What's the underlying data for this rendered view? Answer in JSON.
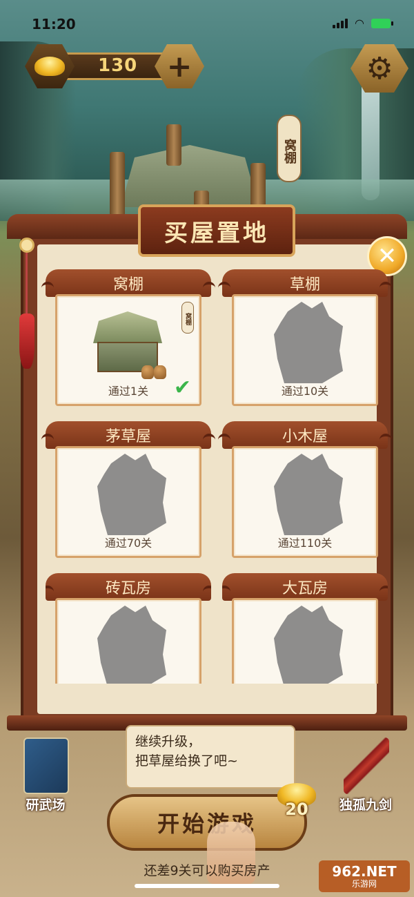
{
  "status_bar": {
    "time": "11:20"
  },
  "hud": {
    "coins": "130",
    "add_label": "+",
    "settings_icon": "gear-icon"
  },
  "scene": {
    "sign": "窝棚"
  },
  "modal": {
    "title": "买屋置地",
    "close_label": "✕",
    "cards": [
      {
        "name": "窝棚",
        "requirement": "通过1关",
        "unlocked": true,
        "sign": "窝棚"
      },
      {
        "name": "草棚",
        "requirement": "通过10关",
        "unlocked": false
      },
      {
        "name": "茅草屋",
        "requirement": "通过70关",
        "unlocked": false
      },
      {
        "name": "小木屋",
        "requirement": "通过110关",
        "unlocked": false
      },
      {
        "name": "砖瓦房",
        "requirement": "",
        "unlocked": false
      },
      {
        "name": "大瓦房",
        "requirement": "",
        "unlocked": false
      }
    ]
  },
  "speech": {
    "line1": "继续升级，",
    "line2": "把草屋给换了吧~"
  },
  "left_button": {
    "label": "研武场"
  },
  "right_button": {
    "label": "独孤九剑"
  },
  "start": {
    "label": "开始游戏",
    "reward": "20"
  },
  "hint": "还差9关可以购买房产",
  "watermark": {
    "line1": "962.NET",
    "line2": "乐游网"
  }
}
